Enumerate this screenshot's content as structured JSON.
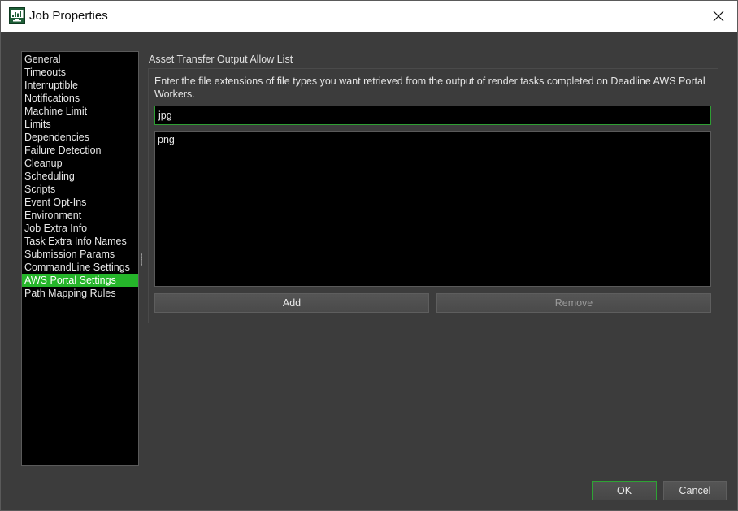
{
  "window": {
    "title": "Job Properties"
  },
  "sidebar": {
    "items": [
      {
        "label": "General",
        "selected": false
      },
      {
        "label": "Timeouts",
        "selected": false
      },
      {
        "label": "Interruptible",
        "selected": false
      },
      {
        "label": "Notifications",
        "selected": false
      },
      {
        "label": "Machine Limit",
        "selected": false
      },
      {
        "label": "Limits",
        "selected": false
      },
      {
        "label": "Dependencies",
        "selected": false
      },
      {
        "label": "Failure Detection",
        "selected": false
      },
      {
        "label": "Cleanup",
        "selected": false
      },
      {
        "label": "Scheduling",
        "selected": false
      },
      {
        "label": "Scripts",
        "selected": false
      },
      {
        "label": "Event Opt-Ins",
        "selected": false
      },
      {
        "label": "Environment",
        "selected": false
      },
      {
        "label": "Job Extra Info",
        "selected": false
      },
      {
        "label": "Task Extra Info Names",
        "selected": false
      },
      {
        "label": "Submission Params",
        "selected": false
      },
      {
        "label": "CommandLine Settings",
        "selected": false
      },
      {
        "label": "AWS Portal Settings",
        "selected": true
      },
      {
        "label": "Path Mapping Rules",
        "selected": false
      }
    ]
  },
  "panel": {
    "group_label": "Asset Transfer Output Allow List",
    "description": "Enter the file extensions of file types you want retrieved from the output of render tasks completed on Deadline AWS Portal Workers.",
    "input_value": "jpg",
    "extensions": [
      "png"
    ],
    "add_label": "Add",
    "remove_label": "Remove"
  },
  "footer": {
    "ok_label": "OK",
    "cancel_label": "Cancel"
  },
  "colors": {
    "accent": "#25b52a",
    "background": "#3c3c3c",
    "list_background": "#000000"
  },
  "icons": {
    "app": "monitor-chart-icon",
    "close": "close-icon"
  }
}
